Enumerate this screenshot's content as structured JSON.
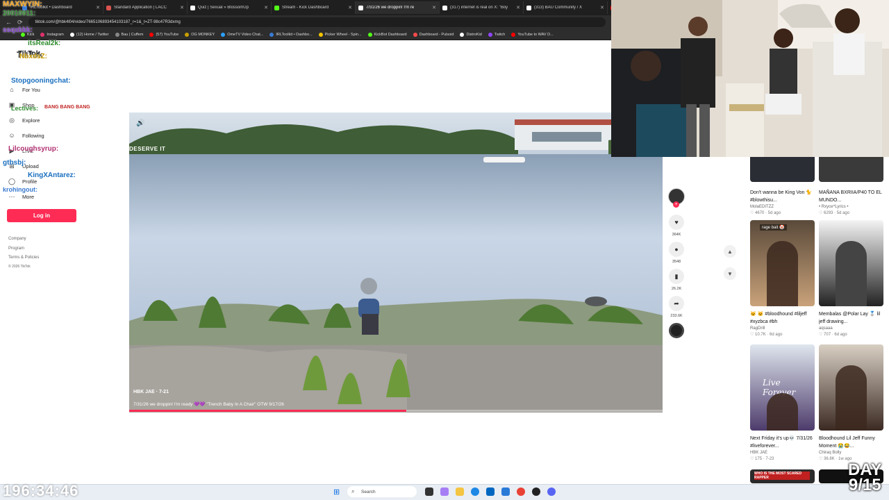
{
  "browser": {
    "tabs": [
      {
        "label": "IRLToolkit • Dashboard",
        "color": "#3a7bd5"
      },
      {
        "label": "Standard Application | LACC",
        "color": "#d9534f"
      },
      {
        "label": "Quiz | Sexual » BlossomUp",
        "color": "#ffffff"
      },
      {
        "label": "Stream - Kick Dashboard",
        "color": "#53fc18"
      },
      {
        "label": "7/31/26 we droppin! I'm re",
        "color": "#ffffff",
        "active": true
      },
      {
        "label": "(317) internet is real on X: \"Boy",
        "color": "#ffffff"
      },
      {
        "label": "(313) BAU Community / X",
        "color": "#ffffff"
      },
      {
        "label": "(960",
        "color": "#ff0000"
      }
    ],
    "url": "tiktok.com/@hbk4l04/video/7665106893454103187_r=1&_t=ZT-98c47R3dxmg",
    "bookmarks": [
      {
        "label": "Kick",
        "color": "#53fc18"
      },
      {
        "label": "Instagram",
        "color": "#e1306c"
      },
      {
        "label": "(12) Home / Twitter",
        "color": "#ffffff"
      },
      {
        "label": "Bau | Cuffem",
        "color": "#888888"
      },
      {
        "label": "(57) YouTube",
        "color": "#ff0000"
      },
      {
        "label": "OG MONKEY",
        "color": "#c8a000"
      },
      {
        "label": "OmeTV Video Chat...",
        "color": "#2aa1ff"
      },
      {
        "label": "IRLToolkit • Dashbo...",
        "color": "#3a7bd5"
      },
      {
        "label": "Picker Wheel - Spin...",
        "color": "#f5c400"
      },
      {
        "label": "KickBot Dashboard",
        "color": "#53fc18"
      },
      {
        "label": "Dashboard - Pulsoid",
        "color": "#ff4a4a"
      },
      {
        "label": "DistroKid",
        "color": "#ffffff"
      },
      {
        "label": "Twitch",
        "color": "#9146ff"
      },
      {
        "label": "YouTube to WAV D...",
        "color": "#ff0000"
      }
    ]
  },
  "tiktok": {
    "logo": "TikTok",
    "nav": [
      {
        "label": "For You",
        "icon": "home-icon"
      },
      {
        "label": "Shop",
        "icon": "shop-icon"
      },
      {
        "label": "Explore",
        "icon": "compass-icon"
      },
      {
        "label": "Following",
        "icon": "people-icon"
      },
      {
        "label": "LIVE",
        "icon": "live-icon"
      },
      {
        "label": "Upload",
        "icon": "plus-square-icon"
      },
      {
        "label": "Profile",
        "icon": "user-icon"
      },
      {
        "label": "More",
        "icon": "more-icon"
      }
    ],
    "login": "Log in",
    "footer": [
      "Company",
      "Program",
      "Terms & Policies",
      "© 2026 TikTok"
    ],
    "video": {
      "author": "HBK JAE · 7-21",
      "caption": "7/31/26 we droppin! I'm ready 💜💜 \"Trench Baby In A Chair\" OTW 9/17/26",
      "overlay": "DESERVE IT",
      "progress": 0.52
    },
    "actions": [
      {
        "name": "like",
        "icon": "heart-icon",
        "count": "364K"
      },
      {
        "name": "comment",
        "icon": "comment-icon",
        "count": "3548"
      },
      {
        "name": "save",
        "icon": "bookmark-icon",
        "count": "26.2K"
      },
      {
        "name": "share",
        "icon": "share-icon",
        "count": "233.6K"
      }
    ],
    "grid": [
      {
        "title": "Don't wanna be King Von 🐈 #blowthisu...",
        "author": "MolaEDITZZ",
        "stats": "♡ 4670 · 5d ago"
      },
      {
        "title": "MAÑANA BXRIIA/P40 TO EL MUNDO...",
        "author": "• Rxyce^Lyrics •",
        "stats": "♡ 6293 · 5d ago"
      },
      {
        "title": "🐱 🐱 #bloodhound #liljeff #xyzbca #bh",
        "author": "RagDrill",
        "stats": "♡ 10.7K · 6d ago"
      },
      {
        "title": "Membalas @Polar Lay 🥈 lil jeff drawing...",
        "author": "aqsaaa",
        "stats": "♡ 707 · 6d ago"
      },
      {
        "title": "Next Friday it's up💀 7/31/26 #liveforever...",
        "author": "HBK JAE",
        "stats": "♡ 175 · 7-23"
      },
      {
        "title": "Bloodhound Lil Jeff Funny Moment 😭😂...",
        "author": "Chiraq Bolly",
        "stats": "♡ 36.8K · 1w ago"
      }
    ],
    "thumb_texts": {
      "rage": "rage bait 🤡",
      "forever": "Live Forever",
      "whoscared": "WHO IS THE MOST SCARED RAPPER"
    }
  },
  "stream": {
    "timer": "196:34:46",
    "day": "DAY",
    "day_count": "9/15",
    "chat_names": [
      "MAXWYIN:",
      "20010911:",
      "ssqxkkk:",
      "itsReal2k:",
      "TikTok",
      "NbxdsZ:",
      "Stopgooningchat:",
      "Lectives:",
      "BANG BANG BANG",
      "Lilcoughsyrup:",
      "gtbsbj:",
      "KingXAntarez:",
      "krohingout:"
    ]
  },
  "taskbar": {
    "search": "Search"
  }
}
